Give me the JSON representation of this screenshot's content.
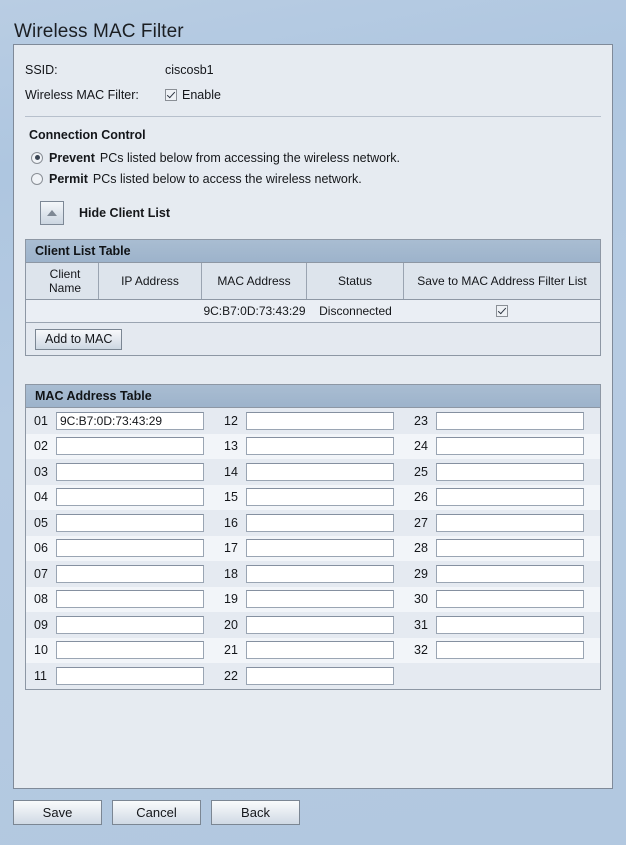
{
  "page": {
    "title": "Wireless MAC Filter"
  },
  "settings": {
    "ssid_label": "SSID:",
    "ssid_value": "ciscosb1",
    "filter_label": "Wireless MAC Filter:",
    "filter_enable_label": "Enable",
    "filter_enabled": true
  },
  "connection_control": {
    "title": "Connection Control",
    "options": [
      {
        "strong": "Prevent",
        "text": "PCs listed below from accessing the wireless network.",
        "selected": true
      },
      {
        "strong": "Permit",
        "text": "PCs listed below to access the wireless network.",
        "selected": false
      }
    ],
    "toggle_label": "Hide Client List",
    "toggle_icon": "chevron-up-icon"
  },
  "client_list": {
    "title": "Client List Table",
    "columns": [
      "Client Name",
      "IP Address",
      "MAC Address",
      "Status",
      "Save to MAC Address Filter List"
    ],
    "rows": [
      {
        "client_name": "",
        "ip_address": "",
        "mac_address": "9C:B7:0D:73:43:29",
        "status": "Disconnected",
        "save_checked": true
      }
    ],
    "add_button": "Add to MAC"
  },
  "mac_table": {
    "title": "MAC Address Table",
    "rows": [
      {
        "c1": {
          "num": "01",
          "value": "9C:B7:0D:73:43:29"
        },
        "c2": {
          "num": "12",
          "value": ""
        },
        "c3": {
          "num": "23",
          "value": ""
        }
      },
      {
        "c1": {
          "num": "02",
          "value": ""
        },
        "c2": {
          "num": "13",
          "value": ""
        },
        "c3": {
          "num": "24",
          "value": ""
        }
      },
      {
        "c1": {
          "num": "03",
          "value": ""
        },
        "c2": {
          "num": "14",
          "value": ""
        },
        "c3": {
          "num": "25",
          "value": ""
        }
      },
      {
        "c1": {
          "num": "04",
          "value": ""
        },
        "c2": {
          "num": "15",
          "value": ""
        },
        "c3": {
          "num": "26",
          "value": ""
        }
      },
      {
        "c1": {
          "num": "05",
          "value": ""
        },
        "c2": {
          "num": "16",
          "value": ""
        },
        "c3": {
          "num": "27",
          "value": ""
        }
      },
      {
        "c1": {
          "num": "06",
          "value": ""
        },
        "c2": {
          "num": "17",
          "value": ""
        },
        "c3": {
          "num": "28",
          "value": ""
        }
      },
      {
        "c1": {
          "num": "07",
          "value": ""
        },
        "c2": {
          "num": "18",
          "value": ""
        },
        "c3": {
          "num": "29",
          "value": ""
        }
      },
      {
        "c1": {
          "num": "08",
          "value": ""
        },
        "c2": {
          "num": "19",
          "value": ""
        },
        "c3": {
          "num": "30",
          "value": ""
        }
      },
      {
        "c1": {
          "num": "09",
          "value": ""
        },
        "c2": {
          "num": "20",
          "value": ""
        },
        "c3": {
          "num": "31",
          "value": ""
        }
      },
      {
        "c1": {
          "num": "10",
          "value": ""
        },
        "c2": {
          "num": "21",
          "value": ""
        },
        "c3": {
          "num": "32",
          "value": ""
        }
      },
      {
        "c1": {
          "num": "11",
          "value": ""
        },
        "c2": {
          "num": "22",
          "value": ""
        },
        "c3": null
      }
    ]
  },
  "footer": {
    "buttons": [
      "Save",
      "Cancel",
      "Back"
    ]
  },
  "colors": {
    "page_background": "#b2c8e0",
    "panel_background": "#e6ebf1",
    "panel_border": "#7f8a99",
    "table_header": "#a1b6cd",
    "row_odd": "#e5eaf1",
    "row_even": "#f2f5f9"
  }
}
